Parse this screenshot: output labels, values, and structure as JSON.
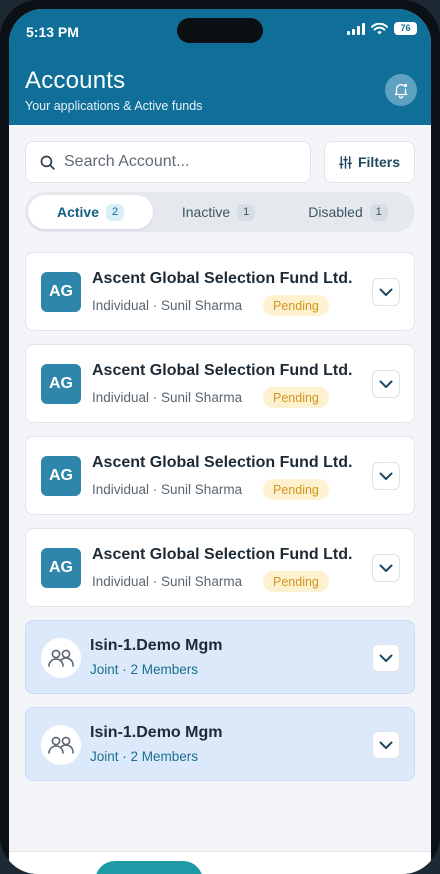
{
  "status": {
    "time": "5:13 PM",
    "battery": "76",
    "icons": [
      "signal-icon",
      "wifi-icon",
      "battery-icon"
    ]
  },
  "header": {
    "title": "Accounts",
    "subtitle": "Your applications & Active funds",
    "bell_icon": "bell-icon"
  },
  "search": {
    "placeholder": "Search Account...",
    "value": "",
    "icon": "search-icon"
  },
  "filters": {
    "label": "Filters",
    "icon": "sliders-icon"
  },
  "tabs": [
    {
      "label": "Active",
      "count": "2",
      "selected": true
    },
    {
      "label": "Inactive",
      "count": "1",
      "selected": false
    },
    {
      "label": "Disabled",
      "count": "1",
      "selected": false
    }
  ],
  "accounts": [
    {
      "initials": "AG",
      "name": "Ascent Global Selection Fund Ltd.",
      "meta": "Individual · Sunil Sharma",
      "status": "Pending"
    },
    {
      "initials": "AG",
      "name": "Ascent Global Selection Fund Ltd.",
      "meta": "Individual · Sunil Sharma",
      "status": "Pending"
    },
    {
      "initials": "AG",
      "name": "Ascent Global Selection Fund Ltd.",
      "meta": "Individual · Sunil Sharma",
      "status": "Pending"
    },
    {
      "initials": "AG",
      "name": "Ascent Global Selection Fund Ltd.",
      "meta": "Individual · Sunil Sharma",
      "status": "Pending"
    }
  ],
  "joint_accounts": [
    {
      "name": "Isin-1.Demo Mgm",
      "meta": "Joint · 2 Members",
      "icon": "users-icon"
    },
    {
      "name": "Isin-1.Demo Mgm",
      "meta": "Joint · 2 Members",
      "icon": "users-icon"
    }
  ],
  "colors": {
    "header": "#0f6f99",
    "accent": "#2e86ab",
    "pending_bg": "#fdf1cf",
    "pending_text": "#d4951b",
    "joint_bg": "#dbe9fb"
  }
}
